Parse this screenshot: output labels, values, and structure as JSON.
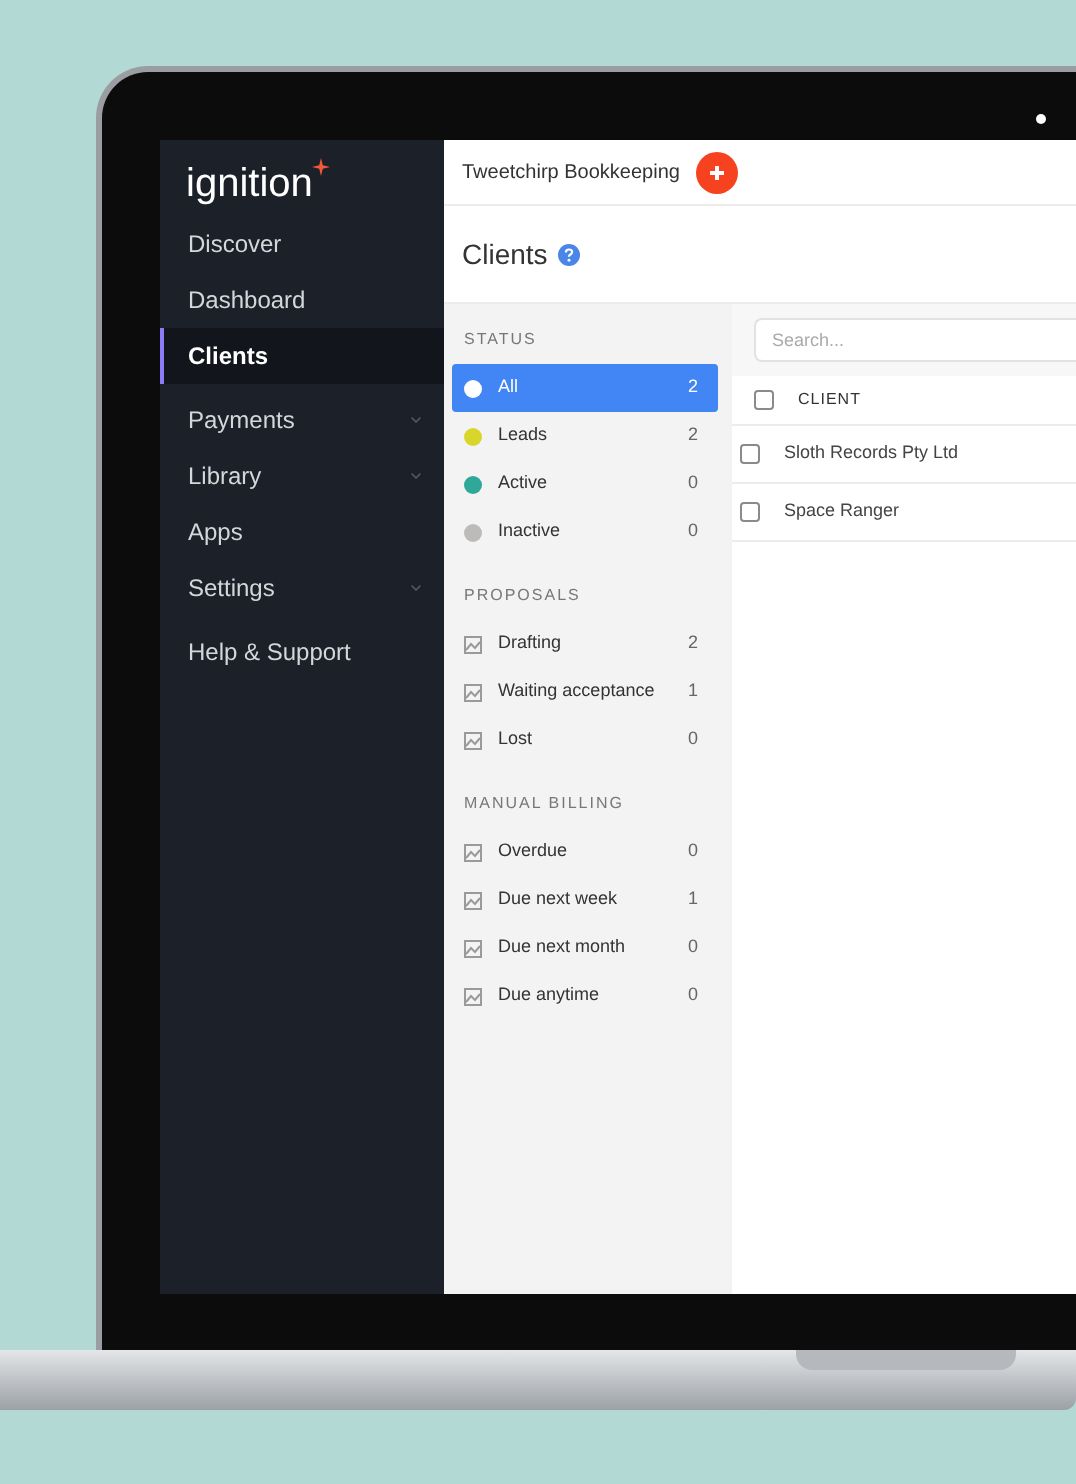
{
  "logo": "ignition",
  "sidebar": {
    "items": [
      {
        "label": "Discover",
        "selected": false,
        "expandable": false
      },
      {
        "label": "Dashboard",
        "selected": false,
        "expandable": false
      },
      {
        "label": "Clients",
        "selected": true,
        "expandable": false
      },
      {
        "label": "Payments",
        "selected": false,
        "expandable": true
      },
      {
        "label": "Library",
        "selected": false,
        "expandable": true
      },
      {
        "label": "Apps",
        "selected": false,
        "expandable": false
      },
      {
        "label": "Settings",
        "selected": false,
        "expandable": true
      },
      {
        "label": "Help & Support",
        "selected": false,
        "expandable": false
      }
    ]
  },
  "header": {
    "business": "Tweetchirp Bookkeeping"
  },
  "page_title": "Clients",
  "filters": [
    {
      "title": "STATUS",
      "items": [
        {
          "kind": "dot",
          "label": "All",
          "count": "2",
          "selected": true,
          "color": "#ffffff"
        },
        {
          "kind": "dot",
          "label": "Leads",
          "count": "2",
          "selected": false,
          "color": "#d9d62b"
        },
        {
          "kind": "dot",
          "label": "Active",
          "count": "0",
          "selected": false,
          "color": "#2fa89a"
        },
        {
          "kind": "dot",
          "label": "Inactive",
          "count": "0",
          "selected": false,
          "color": "#bdbbb9"
        }
      ]
    },
    {
      "title": "PROPOSALS",
      "items": [
        {
          "kind": "icon",
          "label": "Drafting",
          "count": "2",
          "selected": false
        },
        {
          "kind": "icon",
          "label": "Waiting acceptance",
          "count": "1",
          "selected": false
        },
        {
          "kind": "icon",
          "label": "Lost",
          "count": "0",
          "selected": false
        }
      ]
    },
    {
      "title": "MANUAL BILLING",
      "items": [
        {
          "kind": "icon",
          "label": "Overdue",
          "count": "0",
          "selected": false
        },
        {
          "kind": "icon",
          "label": "Due next week",
          "count": "1",
          "selected": false
        },
        {
          "kind": "icon",
          "label": "Due next month",
          "count": "0",
          "selected": false
        },
        {
          "kind": "icon",
          "label": "Due anytime",
          "count": "0",
          "selected": false
        }
      ]
    }
  ],
  "search": {
    "placeholder": "Search..."
  },
  "table": {
    "header_checked": false,
    "column": "CLIENT",
    "rows": [
      {
        "name": "Sloth Records Pty Ltd",
        "checked": false
      },
      {
        "name": "Space Ranger",
        "checked": false
      }
    ]
  }
}
